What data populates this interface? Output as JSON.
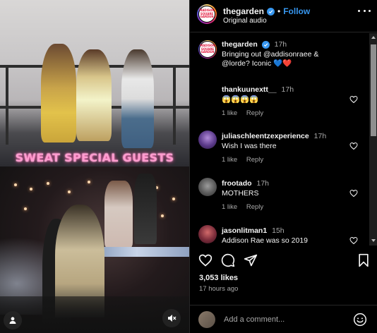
{
  "post": {
    "username": "thegarden",
    "follow_label": "Follow",
    "separator": "•",
    "audio_label": "Original audio",
    "brand_logo_text": "MADISON SQUARE GARDEN",
    "video_banner_text": "SWEAT SPECIAL GUESTS",
    "likes": "3,053 likes",
    "time_ago": "17 hours ago",
    "comment_placeholder": "Add a comment..."
  },
  "caption": {
    "username": "thegarden",
    "time": "17h",
    "text": "Bringing out @addisonraee & @lorde? Iconic 💙❤️"
  },
  "comments": [
    {
      "username": "thankuunextt__",
      "time": "17h",
      "text": "😱😱😱😱",
      "likes": "1 like",
      "reply": "Reply"
    },
    {
      "username": "juliaschleentzexperience",
      "time": "17h",
      "text": "Wish I was there",
      "likes": "1 like",
      "reply": "Reply"
    },
    {
      "username": "frootado",
      "time": "17h",
      "text": "MOTHERS",
      "likes": "1 like",
      "reply": "Reply"
    },
    {
      "username": "jasonlitman1",
      "time": "15h",
      "text": "Addison Rae was so 2019",
      "likes": "",
      "reply": ""
    }
  ],
  "colors": {
    "accent": "#3797f0",
    "text": "#f5f5f5",
    "muted": "#a8a8a8",
    "background": "#000000",
    "banner": "#ff9ccf"
  },
  "icons": {
    "verified": "verified-badge-icon",
    "more": "more-options-icon",
    "heart": "heart-icon",
    "comment": "comment-icon",
    "share": "share-icon",
    "save": "bookmark-icon",
    "emoji": "emoji-icon",
    "mute": "muted-speaker-icon",
    "tagged_user": "user-icon"
  }
}
